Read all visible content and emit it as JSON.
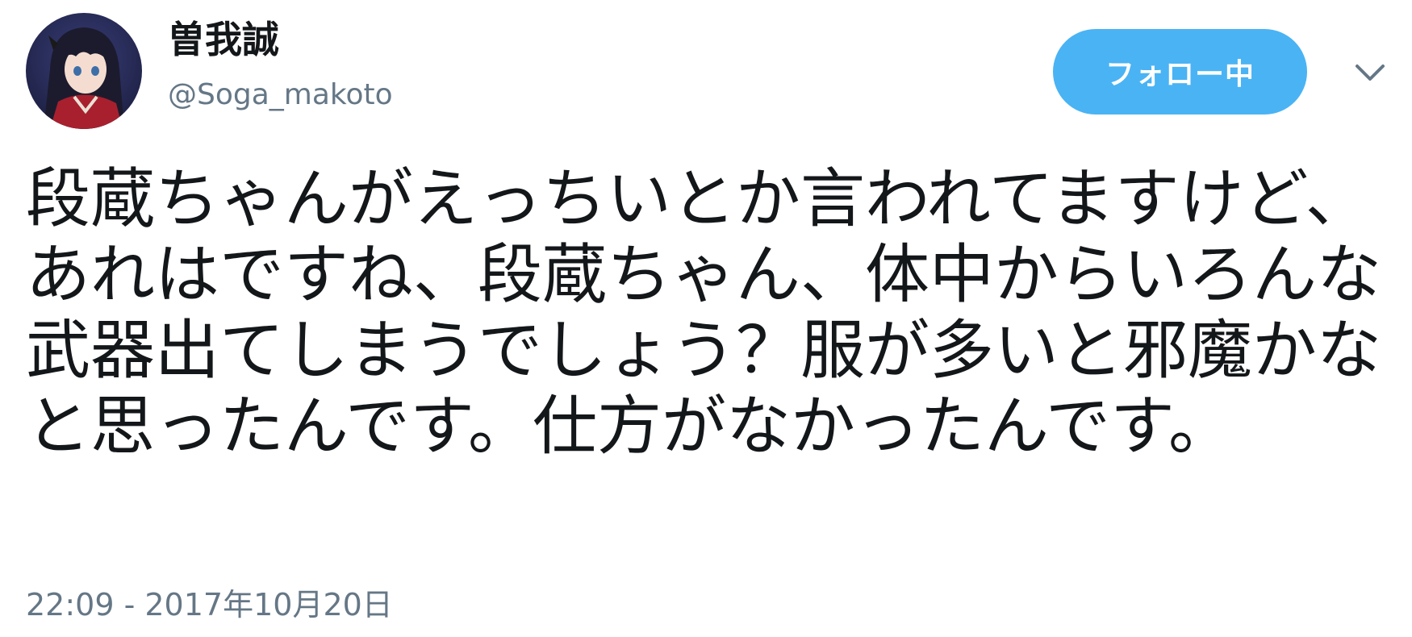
{
  "user": {
    "display_name": "曽我誠",
    "handle": "@Soga_makoto",
    "avatar_icon": "user-avatar-image"
  },
  "follow_button": {
    "label": "フォロー中",
    "color": "#4ab3f4"
  },
  "menu": {
    "icon": "chevron-down-icon"
  },
  "tweet": {
    "text": "段蔵ちゃんがえっちいとか言われてますけど、あれはですね、段蔵ちゃん、体中からいろんな武器出てしまうでしょう？服が多いと邪魔かなと思ったんです。仕方がなかったんです。",
    "timestamp": "22:09 - 2017年10月20日"
  },
  "colors": {
    "text": "#14171a",
    "muted": "#657786",
    "accent": "#4ab3f4"
  }
}
